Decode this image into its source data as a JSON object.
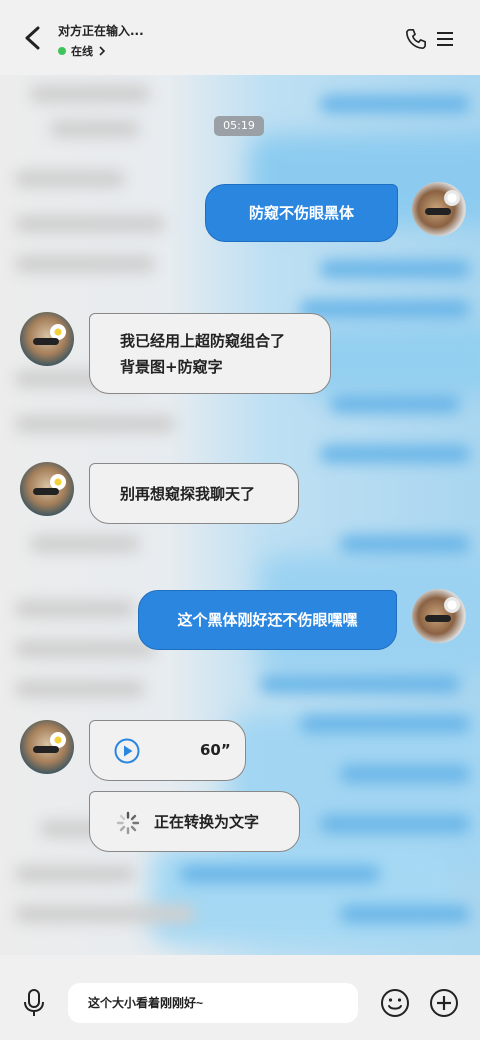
{
  "header": {
    "title": "对方正在输入...",
    "status": "在线",
    "status_color": "#3fc35a"
  },
  "icons": {
    "back": "chevron-left-icon",
    "phone": "phone-icon",
    "menu": "menu-icon",
    "mic": "microphone-icon",
    "emoji": "smiley-icon",
    "plus": "plus-icon",
    "play": "play-icon",
    "spinner": "loading-spinner-icon"
  },
  "chat": {
    "timestamp": "05:19",
    "messages": [
      {
        "from": "me",
        "text": "防窥不伤眼黑体"
      },
      {
        "from": "other",
        "text_line1": "我已经用上超防窥组合了",
        "text_line2": "背景图+防窥字"
      },
      {
        "from": "other",
        "text": "别再想窥探我聊天了"
      },
      {
        "from": "me",
        "text": "这个黑体刚好还不伤眼嘿嘿"
      },
      {
        "from": "other",
        "type": "voice",
        "duration": "60”"
      },
      {
        "from": "other",
        "type": "status",
        "text": "正在转换为文字"
      }
    ]
  },
  "composer": {
    "value": "这个大小看着刚刚好~"
  },
  "colors": {
    "outgoing_bubble": "#2b86e0",
    "incoming_bubble": "#f1f1f1",
    "accent": "#2b86e0"
  }
}
